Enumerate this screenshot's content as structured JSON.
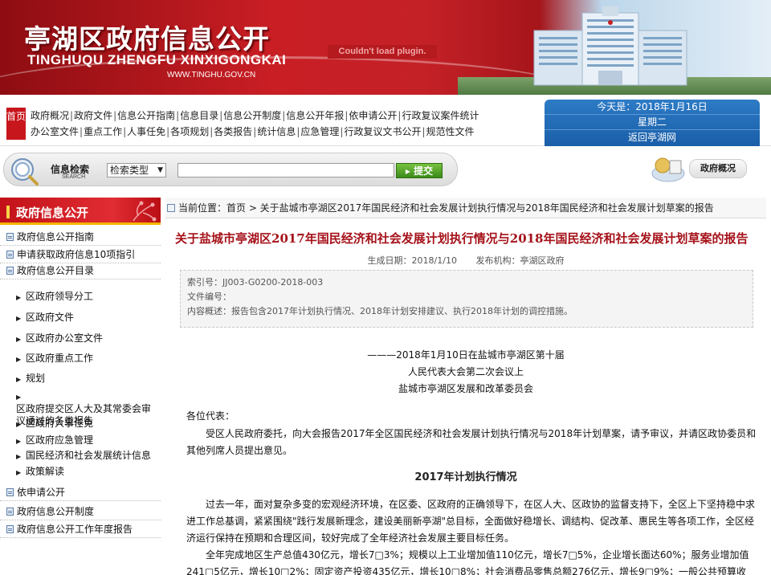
{
  "banner": {
    "title_cn": "亭湖区政府信息公开",
    "title_en": "TINGHUQU ZHENGFU XINXIGONGKAI",
    "url": "WWW.TINGHU.GOV.CN",
    "plugin_msg": "Couldn't load plugin."
  },
  "topnav": {
    "home": "首页",
    "row1": [
      "政府概况",
      "政府文件",
      "信息公开指南",
      "信息目录",
      "信息公开制度",
      "信息公开年报",
      "依申请公开",
      "行政复议案件统计"
    ],
    "row2": [
      "办公室文件",
      "重点工作",
      "人事任免",
      "各项规划",
      "各类报告",
      "统计信息",
      "应急管理",
      "行政复议文书公开",
      "规范性文件"
    ]
  },
  "datebox": {
    "today": "今天是：2018年1月16日",
    "weekday": "星期二",
    "back": "返回亭湖网"
  },
  "search": {
    "label_cn": "信息检索",
    "label_en": "SEARCH",
    "type_select": "检索类型",
    "submit": "提交",
    "overview": "政府概况"
  },
  "sidebar": {
    "title": "政府信息公开",
    "top_items": [
      "政府信息公开指南",
      "申请获取政府信息10项指引",
      "政府信息公开目录"
    ],
    "sub_items": [
      "区政府领导分工",
      "区政府文件",
      "区政府办公室文件",
      "区政府重点工作",
      "规划",
      "区政府提交区人大及其常委会审议通过的各类报告",
      "区政府人事任免",
      "区政府应急管理",
      "国民经济和社会发展统计信息",
      "政策解读"
    ],
    "bottom_items": [
      "依申请公开",
      "政府信息公开制度",
      "政府信息公开工作年度报告"
    ]
  },
  "main": {
    "crumb": "当前位置：首页 > 关于盐城市亭湖区2017年国民经济和社会发展计划执行情况与2018年国民经济和社会发展计划草案的报告",
    "title": "关于盐城市亭湖区2017年国民经济和社会发展计划执行情况与2018年国民经济和社会发展计划草案的报告",
    "date": "生成日期：2018/1/10",
    "publisher": "发布机构：亭湖区政府",
    "index_no": "索引号：JJ003-G0200-2018-003",
    "doc_no": "文件编号：",
    "summary": "内容概述：报告包含2017年计划执行情况、2018年计划安排建议、执行2018年计划的调控措施。",
    "address_lines": [
      "———2018年1月10日在盐城市亭湖区第十届",
      "人民代表大会第二次会议上",
      "盐城市亭湖区发展和改革委员会"
    ],
    "salutation": "各位代表：",
    "intro": "受区人民政府委托，向大会报告2017年全区国民经济和社会发展计划执行情况与2018年计划草案，请予审议，并请区政协委员和其他列席人员提出意见。",
    "section1": "2017年计划执行情况",
    "para1": "过去一年，面对复杂多变的宏观经济环境，在区委、区政府的正确领导下，在区人大、区政协的监督支持下，全区上下坚持稳中求进工作总基调，紧紧围绕\"践行发展新理念，建设美丽新亭湖\"总目标，全面做好稳增长、调结构、促改革、惠民生等各项工作，全区经济运行保持在预期和合理区间，较好完成了全年经济社会发展主要目标任务。",
    "para2": "全年完成地区生产总值430亿元，增长7□3%；规模以上工业增加值110亿元，增长7□5%，企业增长面达60%；服务业增加值241□5亿元，增长10□2%；固定资产投资435亿元，增长10□8%；社会消费品零售总额276亿元，增长9□9%；一般公共预算收"
  }
}
